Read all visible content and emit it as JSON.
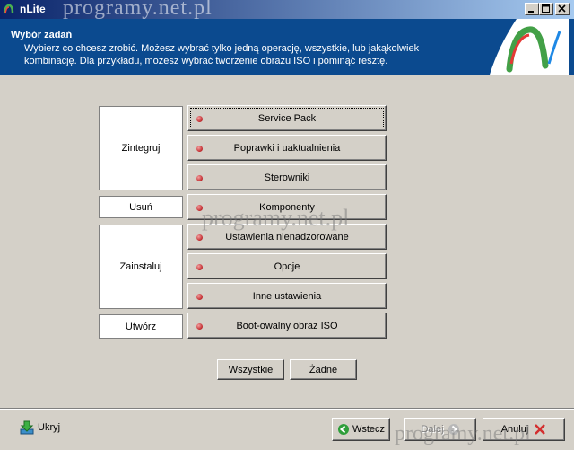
{
  "window": {
    "title": "nLite",
    "watermark": "programy.net.pl"
  },
  "header": {
    "title": "Wybór zadań",
    "description": "Wybierz co chcesz zrobić. Możesz wybrać tylko jedną operację, wszystkie, lub jakąkolwiek kombinację. Dla przykładu, możesz wybrać tworzenie obrazu ISO i pominąć resztę."
  },
  "categories": {
    "integrate": "Zintegruj",
    "remove": "Usuń",
    "install": "Zainstaluj",
    "create": "Utwórz"
  },
  "tasks": {
    "service_pack": "Service Pack",
    "hotfixes": "Poprawki i uaktualnienia",
    "drivers": "Sterowniki",
    "components": "Komponenty",
    "unattended": "Ustawienia nienadzorowane",
    "options": "Opcje",
    "tweaks": "Inne ustawienia",
    "bootable_iso": "Boot-owalny obraz ISO"
  },
  "select_all": "Wszystkie",
  "select_none": "Żadne",
  "footer": {
    "hide": "Ukryj",
    "back": "Wstecz",
    "next": "Dalej",
    "cancel": "Anuluj"
  },
  "colors": {
    "header_bg": "#0b4a8f",
    "titlebar": "#0a246a",
    "task_dot": "#c0282c"
  }
}
